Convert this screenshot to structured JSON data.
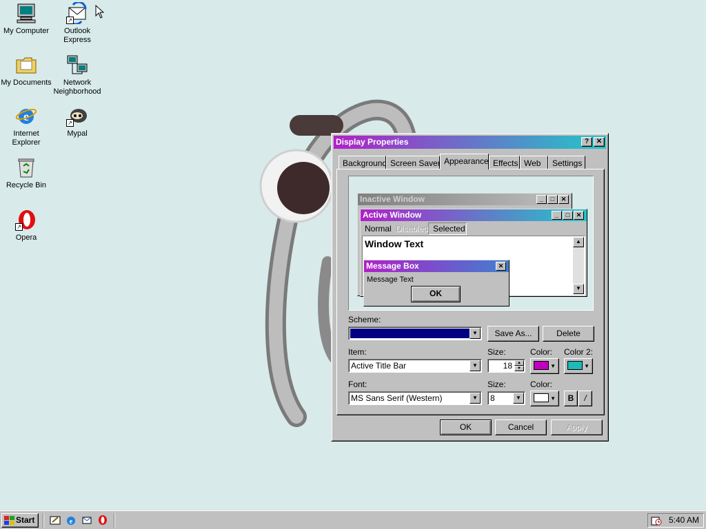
{
  "desktop": {
    "icons": [
      {
        "label": "My Computer",
        "icon": "computer-icon"
      },
      {
        "label": "Outlook Express",
        "icon": "outlook-express-icon"
      },
      {
        "label": "My Documents",
        "icon": "folder-icon"
      },
      {
        "label": "Network Neighborhood",
        "icon": "network-icon"
      },
      {
        "label": "Internet Explorer",
        "icon": "ie-icon"
      },
      {
        "label": "Mypal",
        "icon": "mypal-icon"
      },
      {
        "label": "Recycle Bin",
        "icon": "recycle-bin-icon"
      },
      {
        "label": "Opera",
        "icon": "opera-icon"
      }
    ]
  },
  "dialog": {
    "title": "Display Properties",
    "help_btn": "?",
    "close_btn": "✕",
    "tabs": [
      "Background",
      "Screen Saver",
      "Appearance",
      "Effects",
      "Web",
      "Settings"
    ],
    "active_tab": "Appearance",
    "preview": {
      "inactive_title": "Inactive Window",
      "active_title": "Active Window",
      "menu": [
        "Normal",
        "Disabled",
        "Selected"
      ],
      "window_text": "Window Text",
      "msgbox_title": "Message Box",
      "msgbox_text": "Message Text",
      "msgbox_ok": "OK"
    },
    "scheme_label": "Scheme:",
    "scheme_value": "",
    "save_as": "Save As...",
    "delete": "Delete",
    "item_label": "Item:",
    "item_value": "Active Title Bar",
    "size_label": "Size:",
    "item_size": "18",
    "color_label": "Color:",
    "color2_label": "Color 2:",
    "color1": "#c000c0",
    "color2": "#20b8b8",
    "font_label": "Font:",
    "font_value": "MS Sans Serif (Western)",
    "font_size_label": "Size:",
    "font_size": "8",
    "font_color_label": "Color:",
    "font_color": "#ffffff",
    "bold": "B",
    "italic": "/",
    "ok": "OK",
    "cancel": "Cancel",
    "apply": "Apply"
  },
  "taskbar": {
    "start": "Start",
    "clock": "5:40 AM"
  },
  "colors": {
    "desktop": "#d8eaea",
    "title_gradient_start": "#b020c8",
    "title_gradient_end": "#20c8c8",
    "scheme_selected": "#000080"
  }
}
